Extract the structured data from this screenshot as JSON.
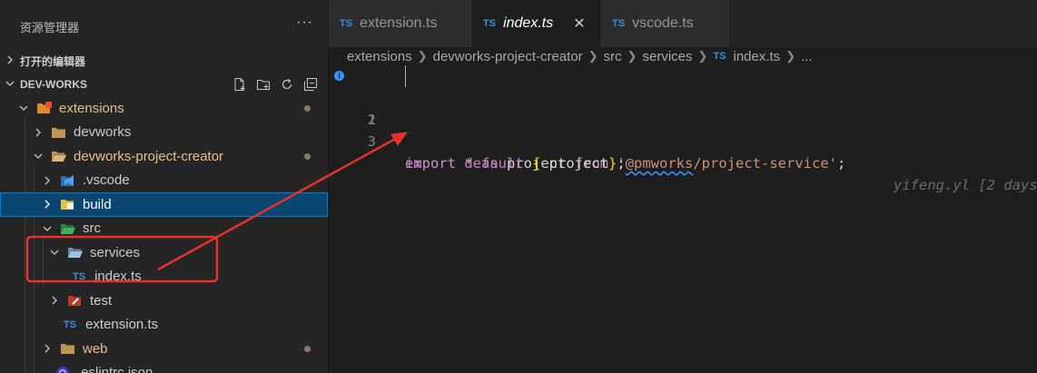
{
  "sidebar": {
    "title": "资源管理器",
    "more": "···",
    "open_editors_label": "打开的编辑器",
    "workspace_label": "DEV-WORKS",
    "tree": [
      {
        "label": "extensions"
      },
      {
        "label": "devworks"
      },
      {
        "label": "devworks-project-creator"
      },
      {
        "label": ".vscode"
      },
      {
        "label": "build"
      },
      {
        "label": "src"
      },
      {
        "label": "services"
      },
      {
        "label": "index.ts",
        "badge": "TS"
      },
      {
        "label": "test"
      },
      {
        "label": "extension.ts",
        "badge": "TS"
      },
      {
        "label": "web"
      },
      {
        "label": ".eslintrc.json"
      }
    ]
  },
  "tabs": [
    {
      "badge": "TS",
      "label": "extension.ts"
    },
    {
      "badge": "TS",
      "label": "index.ts",
      "close": "✕"
    },
    {
      "badge": "TS",
      "label": "vscode.ts"
    }
  ],
  "breadcrumb": {
    "items": [
      "extensions",
      "devworks-project-creator",
      "src",
      "services"
    ],
    "file_badge": "TS",
    "file": "index.ts",
    "more": "..."
  },
  "editor": {
    "line_numbers": [
      "1",
      "2",
      "3"
    ],
    "line1": {
      "import": "import",
      "star": " * ",
      "as": "as",
      "name": " project ",
      "from": "from",
      "space": " ",
      "q1": "'",
      "module_squig": "@pmworks",
      "module_rest": "/project-service",
      "q2": "'",
      "semi": ";",
      "blame": "yifeng.yl [2 days"
    },
    "line3": {
      "export": "export",
      "default": " default ",
      "open": "{",
      "name": " project",
      "close": "}",
      "semi": ";"
    }
  },
  "colors": {
    "sidebar_bg": "#252526",
    "editor_bg": "#1e1e1e",
    "selection": "#094771",
    "annotation": "#e5322d"
  }
}
